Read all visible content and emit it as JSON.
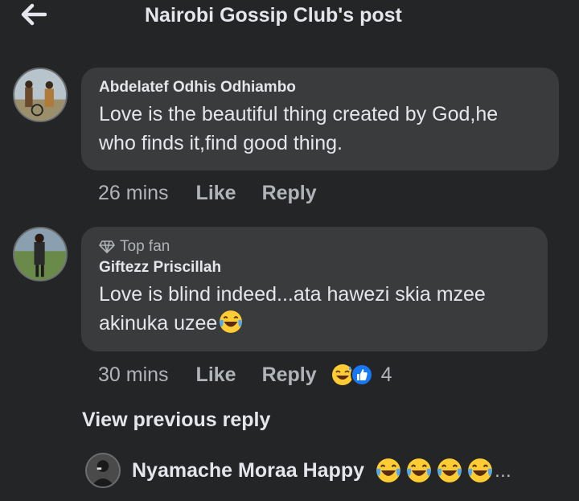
{
  "header": {
    "title": "Nairobi Gossip Club's post",
    "back_icon": "arrow-left-icon"
  },
  "comments": [
    {
      "author": "Abdelatef Odhis Odhiambo",
      "text_line1": "Love is the beautiful thing created by God,he",
      "text_line2": "who finds it,find good thing.",
      "time": "26 mins",
      "like_label": "Like",
      "reply_label": "Reply"
    },
    {
      "badge": "Top fan",
      "badge_icon": "diamond-icon",
      "author": "Giftezz Priscillah",
      "text_line1": "Love is blind indeed...ata hawezi skia mzee",
      "text_line2": "akinuka uzee",
      "text_emoji": "laughing-tears-emoji",
      "time": "30 mins",
      "like_label": "Like",
      "reply_label": "Reply",
      "reactions": [
        "grinning-sweat-emoji",
        "like-reaction-icon"
      ],
      "reaction_count": "4"
    }
  ],
  "view_previous": "View previous reply",
  "reply_preview": {
    "author": "Nyamache Moraa Happy",
    "emojis": [
      "laughing-tears-emoji",
      "laughing-tears-emoji",
      "laughing-tears-emoji",
      "laughing-tears-emoji"
    ],
    "ellipsis": "..."
  },
  "colors": {
    "background": "#242526",
    "bubble": "#3a3b3c",
    "text": "#e4e6eb",
    "secondary_text": "#b0b3b8",
    "like_blue": "#1877f2",
    "emoji_yellow": "#ffcc33"
  }
}
